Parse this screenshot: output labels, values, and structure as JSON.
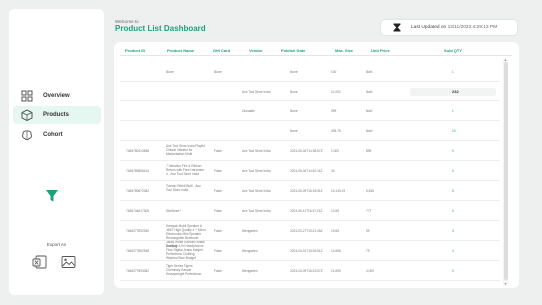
{
  "header": {
    "welcome": "Welcome to",
    "title": "Product List Dashboard",
    "last_updated_label": "Last Updated on",
    "last_updated_value": "12/11/2023 4:29:13 PM"
  },
  "sidebar": {
    "nav": [
      {
        "label": "Overview",
        "icon": "overview-grid-icon"
      },
      {
        "label": "Products",
        "icon": "products-box-icon"
      },
      {
        "label": "Cohort",
        "icon": "cohort-brain-icon"
      }
    ],
    "filter_icon": "filter-icon",
    "export_label": "Export As",
    "export_icons": [
      "excel-export-icon",
      "image-export-icon"
    ]
  },
  "colors": {
    "accent": "#1aa37a",
    "active_nav_bg": "#e6f6f1"
  },
  "table": {
    "columns": [
      "Product ID",
      "Product Name",
      "Gift Card",
      "Vendor",
      "Publish Date",
      "Max. Size",
      "Unit Price",
      "Sold QTY"
    ],
    "rows": [
      {
        "id": "",
        "name": "None",
        "gift": "None",
        "vendor": "",
        "date": "None",
        "size": "100",
        "price": "NaN",
        "sold": "1",
        "highlight": false
      },
      {
        "id": "",
        "name": "",
        "gift": "",
        "vendor": "Ace Tool Store India",
        "date": "None",
        "size": "11,000",
        "price": "NaN",
        "sold": "232",
        "highlight": true
      },
      {
        "id": "",
        "name": "",
        "gift": "",
        "vendor": "Ziocastle",
        "date": "None",
        "size": "999",
        "price": "NaN",
        "sold": "1",
        "highlight": false
      },
      {
        "id": "",
        "name": "",
        "gift": "",
        "vendor": "",
        "date": "None",
        "size": "493.75",
        "price": "NaN",
        "sold": "10",
        "highlight": false
      },
      {
        "id": "7466780413558",
        "name": "Ace Tool Store India Playful Clitoral Vibrator for Masturbation Multi",
        "gift": "False",
        "vendor": "Ace Tool Store India",
        "date": "2024-05-04T14:38:57Z",
        "size": "1,000",
        "price": "899",
        "sold": "9",
        "highlight": false
      },
      {
        "id": "7466789856414",
        "name": "7 Variation Fire & Ribbon Return with Free Harvester 4 - Ace Tool Store India",
        "gift": "False",
        "vendor": "Ace Tool Store India",
        "date": "2024-05-04T14:40:11Z",
        "size": "34",
        "price": "",
        "sold": "0",
        "highlight": false
      },
      {
        "id": "7466789672082",
        "name": "Tomato Ribbit Bulb - Ace Tool Store India",
        "gift": "False",
        "vendor": "Ace Tool Store India",
        "date": "2024-05-09T16:18:51Z",
        "size": "10,145.19",
        "price": "6,636",
        "sold": "5",
        "highlight": false
      },
      {
        "id": "7466744617305",
        "name": "StarSeed *",
        "gift": "False",
        "vendor": "Ace Tool Store India",
        "date": "2024-06-11T15:47:21Z",
        "size": "10.55",
        "price": "777",
        "sold": "0",
        "highlight": false
      },
      {
        "id": "7466277892250",
        "name": "Kamyab Mobil Speaker & JB5T High Quality 4 + Micro Electronics Mini Speaker Rechargable Bluetooth Jacks White Kanvarz Bhatti Drafting",
        "gift": "False",
        "vendor": "Wengarten",
        "date": "2024-03-27T15:21:45Z",
        "size": "19.66",
        "price": "59",
        "sold": "3",
        "highlight": false
      },
      {
        "id": "7466277892548",
        "name": "Kamyab 4-IN Headphones Flow Digital Jeans Kanjeri Perfectiono Clothing Washed Blue Budget",
        "gift": "False",
        "vendor": "Wengarten",
        "date": "2024-04-01T15:26:51Z",
        "size": "14,666",
        "price": "79",
        "sold": "4",
        "highlight": false
      },
      {
        "id": "7466277893062",
        "name": "Tiger Series Tigers Chemistry Kasvar Heavyweight Perfectiono",
        "gift": "False",
        "vendor": "Wengarten",
        "date": "2024-04-09T16:23:57Z",
        "size": "21,690",
        "price": "4,000",
        "sold": "0",
        "highlight": false
      }
    ]
  }
}
